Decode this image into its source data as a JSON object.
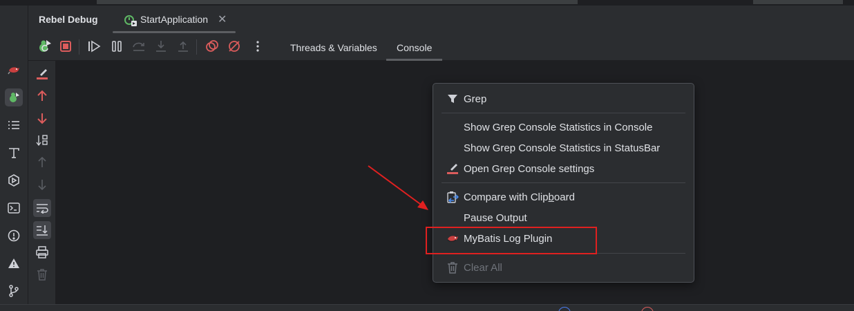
{
  "debug_panel": {
    "title": "Rebel Debug",
    "session_tab": "StartApplication",
    "view_tabs": [
      "Threads & Variables",
      "Console"
    ],
    "active_view": "Console"
  },
  "context_menu": {
    "items": [
      {
        "label": "Grep",
        "icon": "filter-icon",
        "enabled": true
      },
      {
        "label": "Show Grep Console Statistics in Console",
        "icon": "",
        "enabled": true
      },
      {
        "label": "Show Grep Console Statistics in StatusBar",
        "icon": "",
        "enabled": true
      },
      {
        "label": "Open Grep Console settings",
        "icon": "grep-settings-icon",
        "enabled": true
      },
      {
        "label_pre": "Compare with Clip",
        "label_mnemonic": "b",
        "label_post": "oard",
        "icon": "clipboard-compare-icon",
        "enabled": true
      },
      {
        "label": "Pause Output",
        "icon": "",
        "enabled": true
      },
      {
        "label": "MyBatis Log Plugin",
        "icon": "mybatis-bird-icon",
        "enabled": true
      },
      {
        "label": "Clear All",
        "icon": "trash-icon",
        "enabled": false
      }
    ]
  },
  "colors": {
    "annotation": "#e02020",
    "stop": "#db5c5c",
    "accent_green": "#5fb865"
  }
}
